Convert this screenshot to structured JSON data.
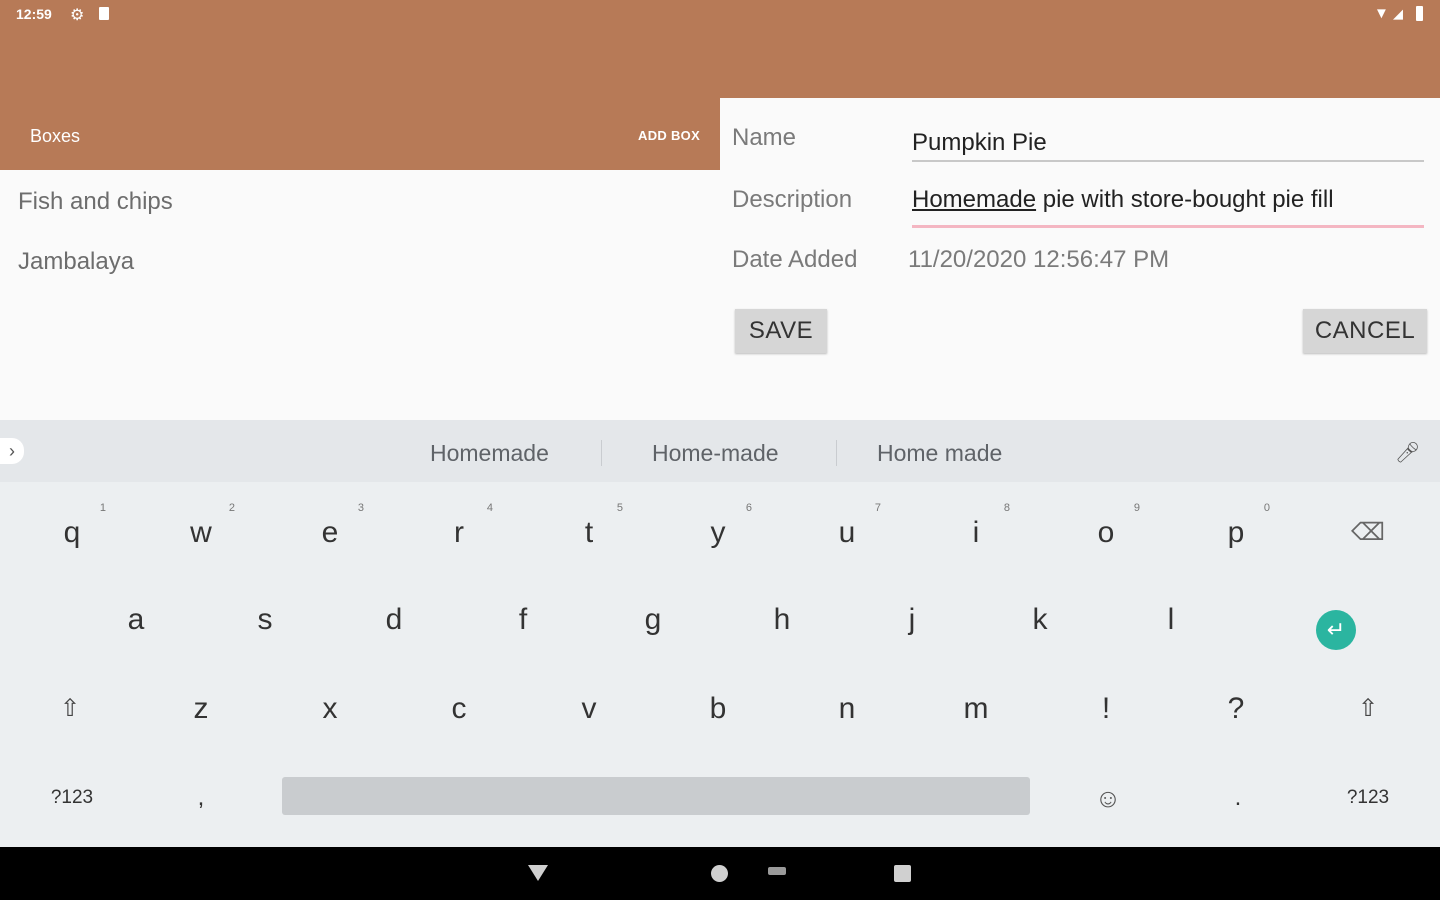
{
  "status_bar": {
    "time": "12:59",
    "icons": [
      "settings-icon",
      "sd-card-icon",
      "wifi-icon",
      "signal-icon",
      "battery-icon"
    ]
  },
  "app_bar": {
    "title": "Boxes",
    "action": "ADD BOX",
    "color": "#b77a57"
  },
  "list": {
    "items": [
      "Fish and chips",
      "Jambalaya"
    ]
  },
  "detail": {
    "name_label": "Name",
    "name_value": "Pumpkin Pie",
    "description_label": "Description",
    "description_underlined": "Homemade",
    "description_rest": " pie with store-bought pie fill",
    "date_label": "Date Added",
    "date_value": "11/20/2020 12:56:47 PM",
    "save_label": "SAVE",
    "cancel_label": "CANCEL"
  },
  "keyboard": {
    "suggestions": [
      "Homemade",
      "Home-made",
      "Home made"
    ],
    "row1": [
      "q",
      "w",
      "e",
      "r",
      "t",
      "y",
      "u",
      "i",
      "o",
      "p"
    ],
    "row1_hints": [
      "1",
      "2",
      "3",
      "4",
      "5",
      "6",
      "7",
      "8",
      "9",
      "0"
    ],
    "row2": [
      "a",
      "s",
      "d",
      "f",
      "g",
      "h",
      "j",
      "k",
      "l"
    ],
    "row3": [
      "z",
      "x",
      "c",
      "v",
      "b",
      "n",
      "m",
      "!",
      "?"
    ],
    "symbols_label": "?123",
    "comma": ",",
    "period": ".",
    "accent_color": "#2bb5a0"
  }
}
